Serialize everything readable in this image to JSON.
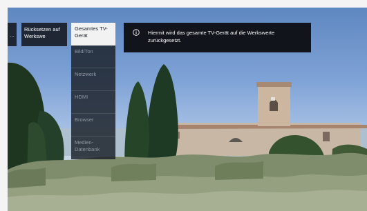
{
  "menu": {
    "prev_indicator": "...",
    "column1": {
      "selected_label": "Rücksetzen auf Werkswe"
    },
    "column2": {
      "items": [
        {
          "label": "Gesamtes TV-Gerät",
          "selected": true
        },
        {
          "label": "Bild/Ton",
          "selected": false
        },
        {
          "label": "Netzwerk",
          "selected": false
        },
        {
          "label": "HDMI",
          "selected": false
        },
        {
          "label": "Browser",
          "selected": false
        },
        {
          "label": "Medien-Datenbank",
          "selected": false
        }
      ]
    }
  },
  "info": {
    "icon": "info-circle-icon",
    "text": "Hiermit wird das gesamte TV-Gerät auf die Werkswerte zurückgesetzt."
  },
  "colors": {
    "menu_bg": "#14181f",
    "selected_bg": "#f2f2f2",
    "text_dim": "#8f97a3",
    "text_light": "#ffffff"
  }
}
